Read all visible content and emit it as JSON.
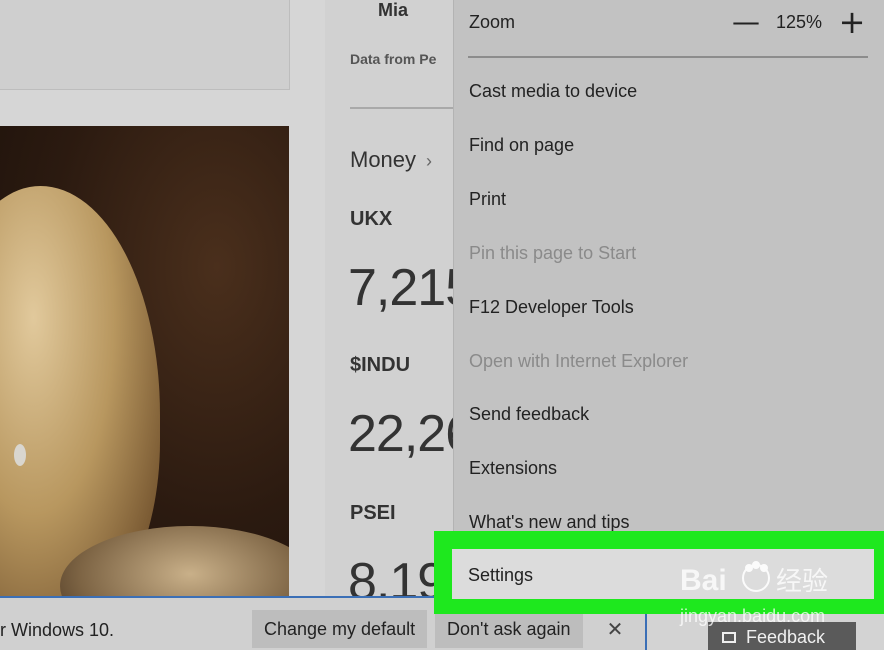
{
  "page": {
    "top_name": "Mia",
    "data_from": "Data from Pe",
    "money_label": "Money",
    "money_chevron": "›",
    "tickers": [
      {
        "symbol": "UKX",
        "value": "7,215"
      },
      {
        "symbol": "$INDU",
        "value": "22,26"
      },
      {
        "symbol": "PSEI",
        "value": "8,19"
      }
    ]
  },
  "notification": {
    "message": "r Windows 10.",
    "change_default": "Change my default",
    "dont_ask": "Don't ask again",
    "close_glyph": "✕"
  },
  "feedback": {
    "label": "Feedback",
    "icon": "chat-bubble-icon"
  },
  "menu": {
    "zoom_label": "Zoom",
    "zoom_minus": "—",
    "zoom_value": "125%",
    "zoom_plus": "+",
    "items": [
      {
        "label": "Cast media to device",
        "enabled": true
      },
      {
        "label": "Find on page",
        "enabled": true
      },
      {
        "label": "Print",
        "enabled": true
      },
      {
        "label": "Pin this page to Start",
        "enabled": false
      },
      {
        "label": "F12 Developer Tools",
        "enabled": true
      },
      {
        "label": "Open with Internet Explorer",
        "enabled": false
      },
      {
        "label": "Send feedback",
        "enabled": true
      },
      {
        "label": "Extensions",
        "enabled": true
      },
      {
        "label": "What's new and tips",
        "enabled": true
      },
      {
        "label": "Settings",
        "enabled": true
      }
    ]
  },
  "highlight": {
    "color": "#1ee81e",
    "target": "Settings"
  },
  "watermark": {
    "text": "jingyan.baidu.com",
    "brand": "Bai",
    "brand_tail": "经验"
  },
  "colors": {
    "accent_blue": "#3b6fb6",
    "menu_bg": "#c2c2c2",
    "disabled_text": "#8a8a8a"
  }
}
